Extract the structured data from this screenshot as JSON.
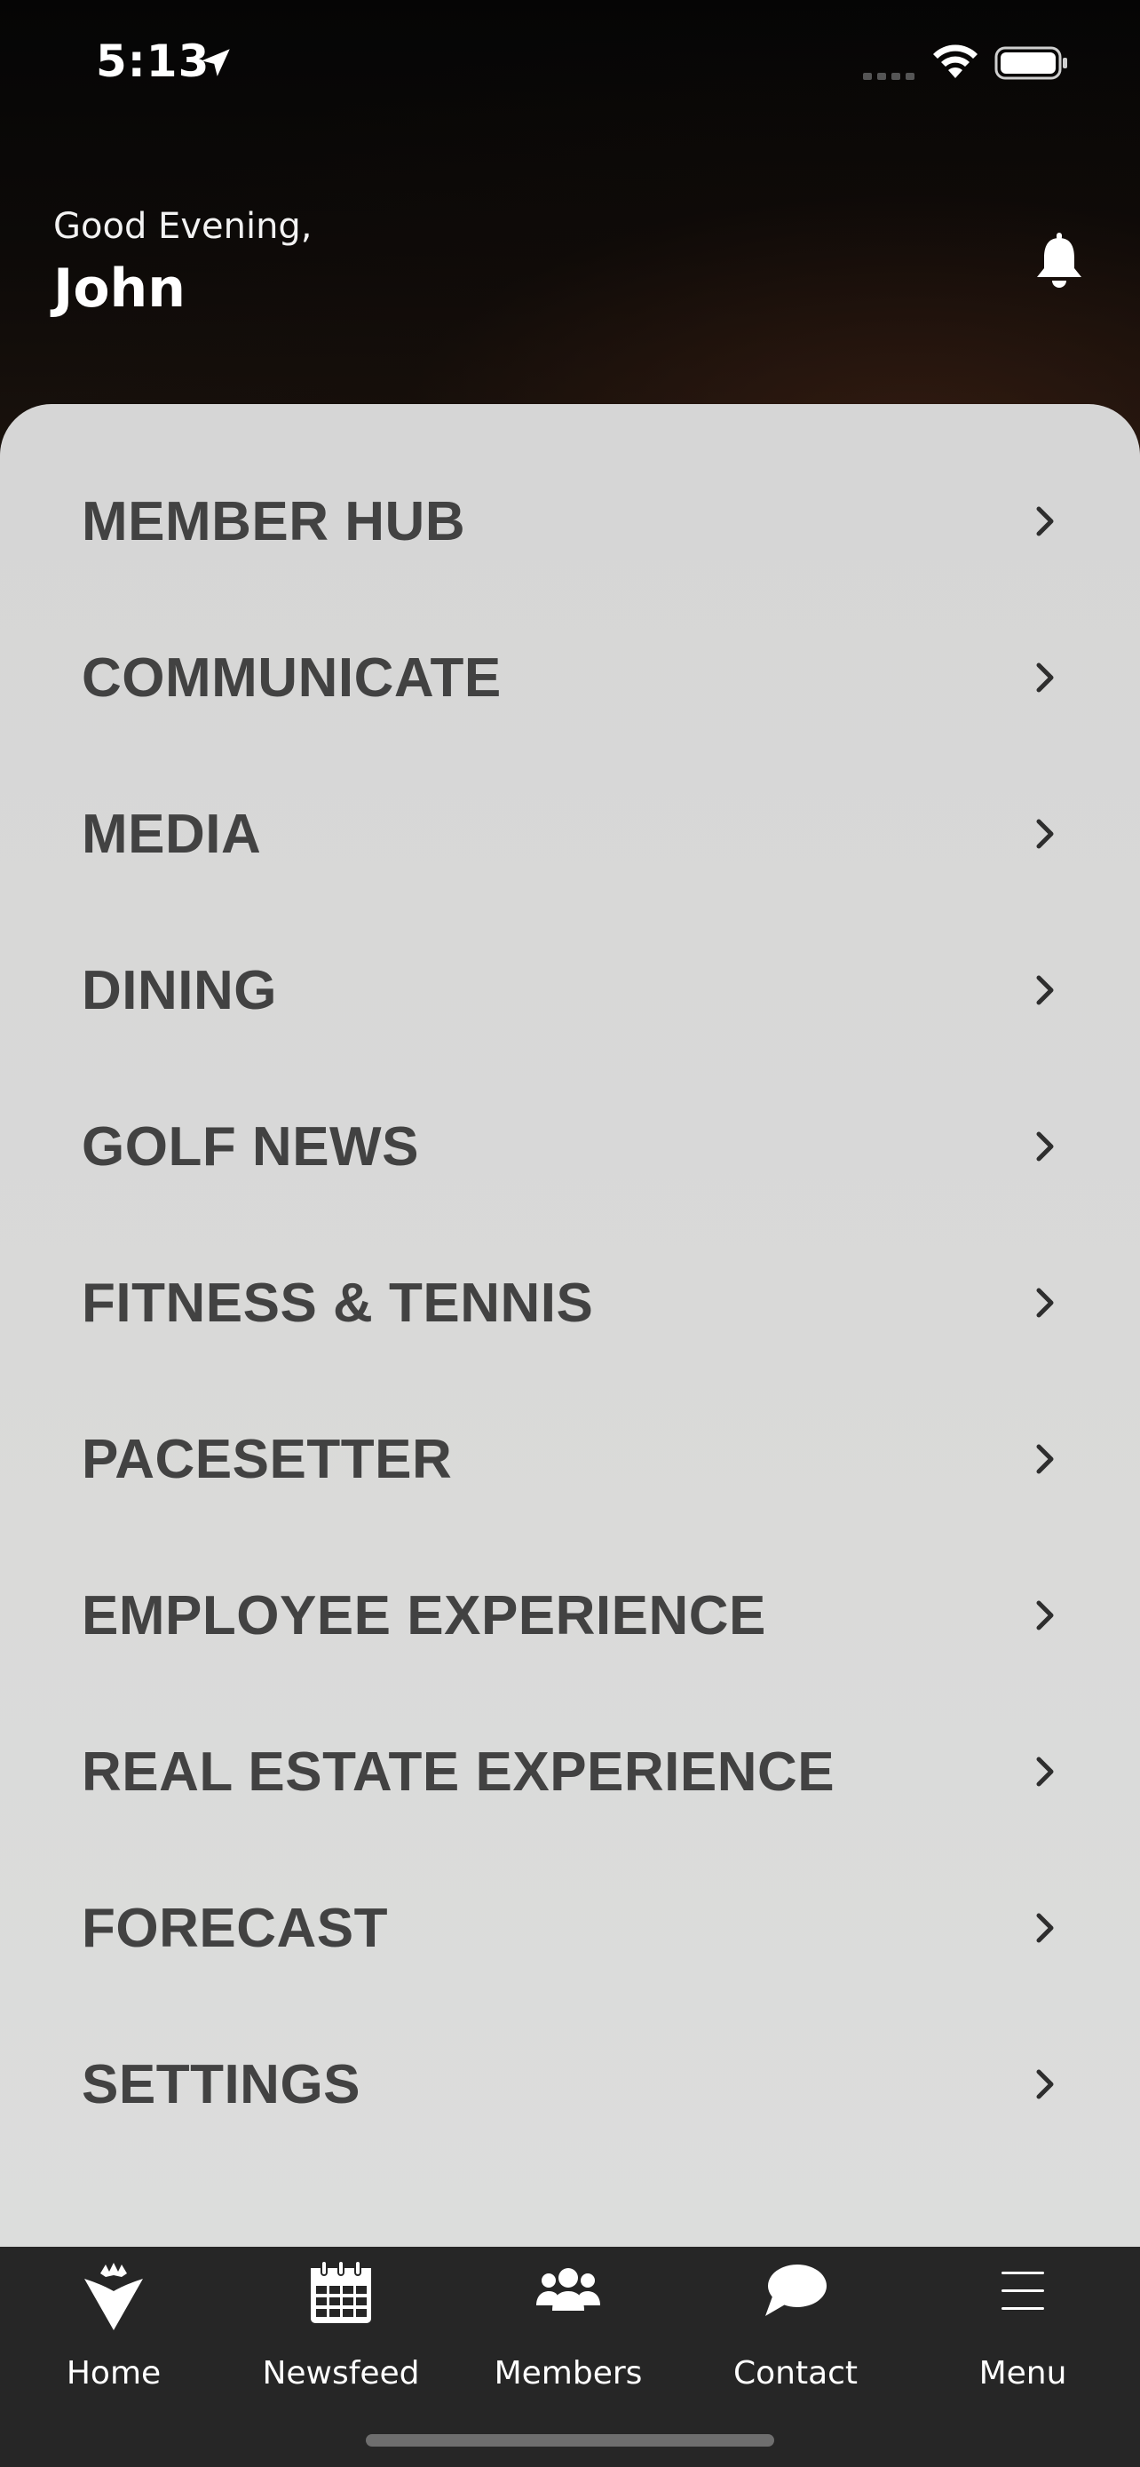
{
  "status_bar": {
    "time": "5:13",
    "location_icon": "location-arrow-icon",
    "signal_icon": "cellular-signal-icon",
    "wifi_icon": "wifi-icon",
    "battery_icon": "battery-icon"
  },
  "header": {
    "greeting": "Good Evening,",
    "name": "John",
    "notification_icon": "bell-icon"
  },
  "menu": {
    "items": [
      {
        "label": "MEMBER HUB"
      },
      {
        "label": "COMMUNICATE"
      },
      {
        "label": "MEDIA"
      },
      {
        "label": "DINING"
      },
      {
        "label": "GOLF NEWS"
      },
      {
        "label": "FITNESS & TENNIS"
      },
      {
        "label": "PACESETTER"
      },
      {
        "label": "EMPLOYEE EXPERIENCE"
      },
      {
        "label": "REAL ESTATE EXPERIENCE"
      },
      {
        "label": "FORECAST"
      },
      {
        "label": "SETTINGS"
      }
    ],
    "chevron_icon": "chevron-right-icon"
  },
  "tab_bar": {
    "tabs": [
      {
        "label": "Home",
        "icon": "crown-logo-icon"
      },
      {
        "label": "Newsfeed",
        "icon": "calendar-icon"
      },
      {
        "label": "Members",
        "icon": "members-group-icon"
      },
      {
        "label": "Contact",
        "icon": "chat-bubble-icon"
      },
      {
        "label": "Menu",
        "icon": "hamburger-menu-icon"
      }
    ]
  },
  "colors": {
    "panel_background": "#d8d8d8",
    "menu_text": "#424242",
    "tab_bar_background": "#262626",
    "header_background": "#0a0806"
  }
}
